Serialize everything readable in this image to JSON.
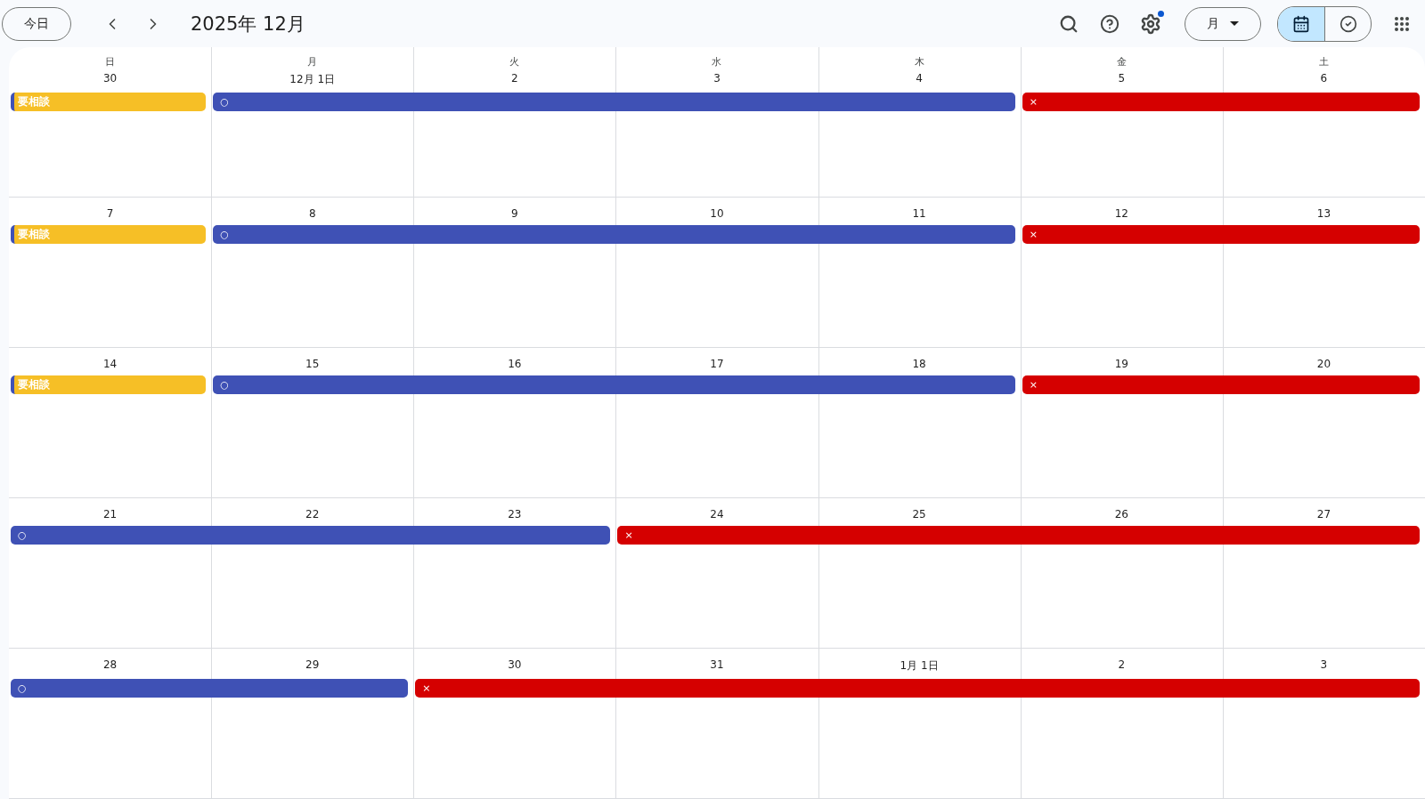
{
  "toolbar": {
    "today_button": "今日",
    "title": "2025年 12月",
    "settings_badge": true,
    "view_select": "月",
    "view_toggle": [
      {
        "kind": "calendar",
        "selected": true
      },
      {
        "kind": "tasks",
        "selected": false
      }
    ]
  },
  "weekdays": [
    "日",
    "月",
    "火",
    "水",
    "木",
    "金",
    "土"
  ],
  "weeks": [
    {
      "days": [
        {
          "date": "30",
          "event": {
            "label": "要相談",
            "color": "#f6bf26"
          }
        },
        {
          "date": "12月 1日",
          "event": {
            "label": "○",
            "color": "#3f51b5"
          }
        },
        {
          "date": "2",
          "continues": true
        },
        {
          "date": "3",
          "continues": true
        },
        {
          "date": "4",
          "continues": true
        },
        {
          "date": "5",
          "event": {
            "label": "×",
            "color": "#d50000"
          }
        },
        {
          "date": "6",
          "continues": true
        }
      ]
    },
    {
      "days": [
        {
          "date": "7",
          "event": {
            "label": "要相談",
            "color": "#f6bf26"
          }
        },
        {
          "date": "8",
          "event": {
            "label": "○",
            "color": "#3f51b5"
          }
        },
        {
          "date": "9",
          "continues": true
        },
        {
          "date": "10",
          "continues": true
        },
        {
          "date": "11",
          "continues": true
        },
        {
          "date": "12",
          "event": {
            "label": "×",
            "color": "#d50000"
          }
        },
        {
          "date": "13",
          "continues": true
        }
      ]
    },
    {
      "days": [
        {
          "date": "14",
          "event": {
            "label": "要相談",
            "color": "#f6bf26"
          }
        },
        {
          "date": "15",
          "event": {
            "label": "○",
            "color": "#3f51b5"
          }
        },
        {
          "date": "16",
          "continues": true
        },
        {
          "date": "17",
          "continues": true
        },
        {
          "date": "18",
          "continues": true
        },
        {
          "date": "19",
          "event": {
            "label": "×",
            "color": "#d50000"
          }
        },
        {
          "date": "20",
          "continues": true
        }
      ]
    },
    {
      "days": [
        {
          "date": "21",
          "event": {
            "label": "○",
            "color": "#3f51b5"
          }
        },
        {
          "date": "22",
          "continues": true
        },
        {
          "date": "23",
          "continues": true
        },
        {
          "date": "24",
          "event": {
            "label": "×",
            "color": "#d50000"
          }
        },
        {
          "date": "25",
          "continues": true
        },
        {
          "date": "26",
          "continues": true
        },
        {
          "date": "27",
          "continues": true
        }
      ]
    },
    {
      "days": [
        {
          "date": "28",
          "event": {
            "label": "○",
            "color": "#3f51b5"
          }
        },
        {
          "date": "29",
          "continues": true
        },
        {
          "date": "30",
          "event": {
            "label": "×",
            "color": "#d50000"
          }
        },
        {
          "date": "31",
          "continues": true
        },
        {
          "date": "1月 1日",
          "continues": true
        },
        {
          "date": "2",
          "continues": true
        },
        {
          "date": "3",
          "continues": true
        }
      ]
    }
  ]
}
